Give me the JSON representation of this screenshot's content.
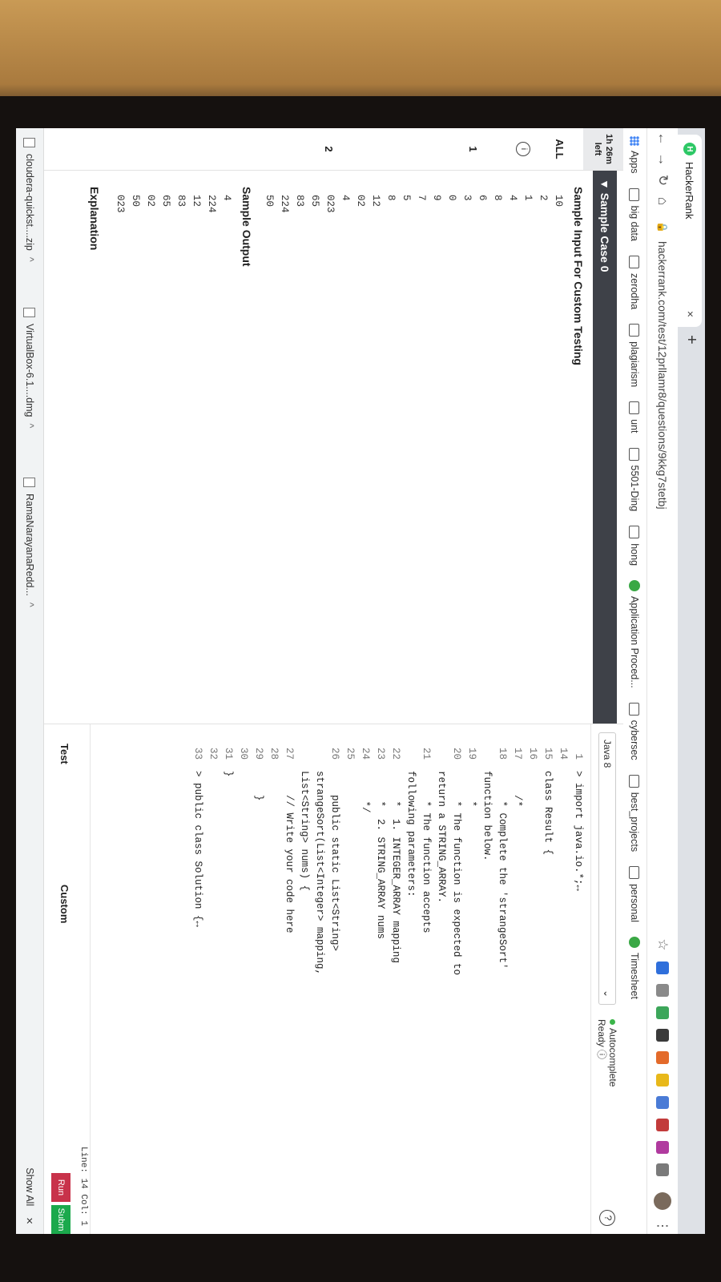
{
  "browser": {
    "tab_title": "HackerRank",
    "tab_icon": "H",
    "tab_close": "×",
    "new_tab": "+",
    "url": "hackerrank.com/test/12prllamr8/questions/9kkg7stetbj",
    "bookmarks": [
      "Apps",
      "big data",
      "zerodha",
      "plagiarism",
      "unt",
      "5501-Ding",
      "hong",
      "Application Proced...",
      "cybersec",
      "best_projects",
      "personal",
      "Timesheet"
    ]
  },
  "rail": {
    "timer_line1": "1h 26m",
    "timer_line2": "left",
    "all": "ALL",
    "info": "i",
    "q1": "1",
    "q2": "2"
  },
  "problem": {
    "section": "▼ Sample Case 0",
    "input_heading": "Sample Input For Custom Testing",
    "input_lines": [
      "10",
      "2",
      "1",
      "4",
      "8",
      "6",
      "3",
      "0",
      "9",
      "7",
      "5",
      "8",
      "12",
      "02",
      "4",
      "023",
      "65",
      "83",
      "224",
      "50"
    ],
    "output_heading": "Sample Output",
    "output_lines": [
      "4",
      "224",
      "12",
      "83",
      "65",
      "02",
      "50",
      "023"
    ],
    "explanation_heading": "Explanation"
  },
  "editor": {
    "language": "Java 8",
    "autocomplete": "Autocomplete",
    "ready": "Ready ⓘ",
    "help": "?",
    "lines": [
      {
        "n": "1",
        "t": "> import java.io.*;↔"
      },
      {
        "n": "14",
        "t": ""
      },
      {
        "n": "15",
        "t": "class Result {"
      },
      {
        "n": "16",
        "t": ""
      },
      {
        "n": "17",
        "t": "    /*"
      },
      {
        "n": "18",
        "t": "     * Complete the 'strangeSort'"
      },
      {
        "n": "",
        "t": "function below."
      },
      {
        "n": "19",
        "t": "     *"
      },
      {
        "n": "20",
        "t": "     * The function is expected to"
      },
      {
        "n": "",
        "t": "return a STRING_ARRAY."
      },
      {
        "n": "21",
        "t": "     * The function accepts"
      },
      {
        "n": "",
        "t": "following parameters:"
      },
      {
        "n": "22",
        "t": "     *  1. INTEGER_ARRAY mapping"
      },
      {
        "n": "23",
        "t": "     *  2. STRING_ARRAY nums"
      },
      {
        "n": "24",
        "t": "     */"
      },
      {
        "n": "25",
        "t": ""
      },
      {
        "n": "26",
        "t": "    public static List<String>"
      },
      {
        "n": "",
        "t": "strangeSort(List<Integer> mapping,"
      },
      {
        "n": "",
        "t": "List<String> nums) {"
      },
      {
        "n": "27",
        "t": "    // Write your code here"
      },
      {
        "n": "28",
        "t": ""
      },
      {
        "n": "29",
        "t": "    }"
      },
      {
        "n": "30",
        "t": ""
      },
      {
        "n": "31",
        "t": "}"
      },
      {
        "n": "32",
        "t": ""
      },
      {
        "n": "33",
        "t": "> public class Solution {↔"
      }
    ],
    "status": "Line: 14 Col: 1",
    "test_tab": "Test",
    "custom_tab": "Custom",
    "run": "Run",
    "submit": "Subm"
  },
  "downloads": {
    "items": [
      "cloudera-quickst....zip",
      "VirtualBox-6.1....dmg",
      "RamaNarayanaRedd..."
    ],
    "show_all": "Show All",
    "close": "×"
  }
}
